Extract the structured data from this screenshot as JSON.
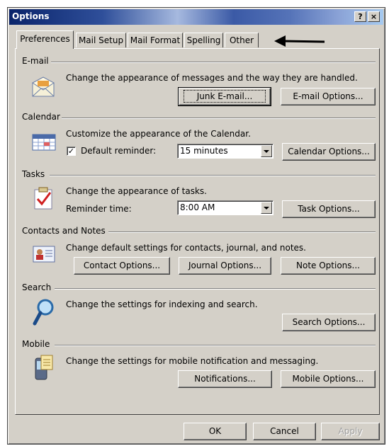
{
  "window": {
    "title": "Options",
    "help_label": "?",
    "close_label": "×"
  },
  "tabs": [
    {
      "label": "Preferences",
      "active": true
    },
    {
      "label": "Mail Setup",
      "active": false
    },
    {
      "label": "Mail Format",
      "active": false
    },
    {
      "label": "Spelling",
      "active": false
    },
    {
      "label": "Other",
      "active": false
    }
  ],
  "sections": {
    "email": {
      "title": "E-mail",
      "description": "Change the appearance of messages and the way they are handled.",
      "junk_button": "Junk E-mail...",
      "options_button": "E-mail Options..."
    },
    "calendar": {
      "title": "Calendar",
      "description": "Customize the appearance of the Calendar.",
      "reminder_label": "Default reminder:",
      "reminder_checked": true,
      "reminder_value": "15 minutes",
      "options_button": "Calendar Options..."
    },
    "tasks": {
      "title": "Tasks",
      "description": "Change the appearance of tasks.",
      "reminder_label": "Reminder time:",
      "reminder_value": "8:00 AM",
      "options_button": "Task Options..."
    },
    "contacts": {
      "title": "Contacts and Notes",
      "description": "Change default settings for contacts, journal, and notes.",
      "contact_button": "Contact Options...",
      "journal_button": "Journal Options...",
      "note_button": "Note Options..."
    },
    "search": {
      "title": "Search",
      "description": "Change the settings for indexing and search.",
      "options_button": "Search Options..."
    },
    "mobile": {
      "title": "Mobile",
      "description": "Change the settings for mobile notification and messaging.",
      "notifications_button": "Notifications...",
      "options_button": "Mobile Options..."
    }
  },
  "footer": {
    "ok": "OK",
    "cancel": "Cancel",
    "apply": "Apply"
  },
  "colors": {
    "dialog_face": "#d4d0c8",
    "title_start": "#0a246a",
    "title_end": "#a6caf0"
  },
  "annotation": {
    "arrow_icon": "left-arrow-icon"
  }
}
